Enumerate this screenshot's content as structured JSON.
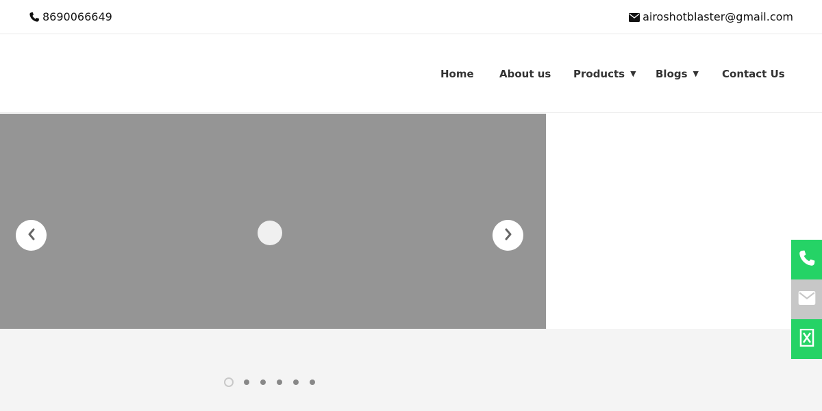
{
  "topbar": {
    "phone": "8690066649",
    "phone_icon": "phone-icon",
    "email": "airoshotblaster@gmail.com",
    "email_icon": "envelope-icon"
  },
  "nav": {
    "items": [
      {
        "label": "Home",
        "has_dropdown": false
      },
      {
        "label": "About us",
        "has_dropdown": false
      },
      {
        "label": "Products",
        "has_dropdown": true
      },
      {
        "label": "Blogs",
        "has_dropdown": true
      },
      {
        "label": "Contact Us",
        "has_dropdown": false
      }
    ],
    "dropdown_caret": "▼"
  },
  "slider": {
    "prev_icon": "chevron-left-icon",
    "next_icon": "chevron-right-icon",
    "background_color": "#959595",
    "dots_count": 6,
    "active_dot_index": 0
  },
  "side_contact": {
    "buttons": [
      {
        "icon": "phone-icon",
        "color": "#25d366"
      },
      {
        "icon": "envelope-icon",
        "color": "#c7c7c7"
      },
      {
        "icon": "excel-icon",
        "color": "#25d366"
      }
    ]
  },
  "colors": {
    "accent_green": "#25d366",
    "band_background": "#f4f4f4"
  }
}
